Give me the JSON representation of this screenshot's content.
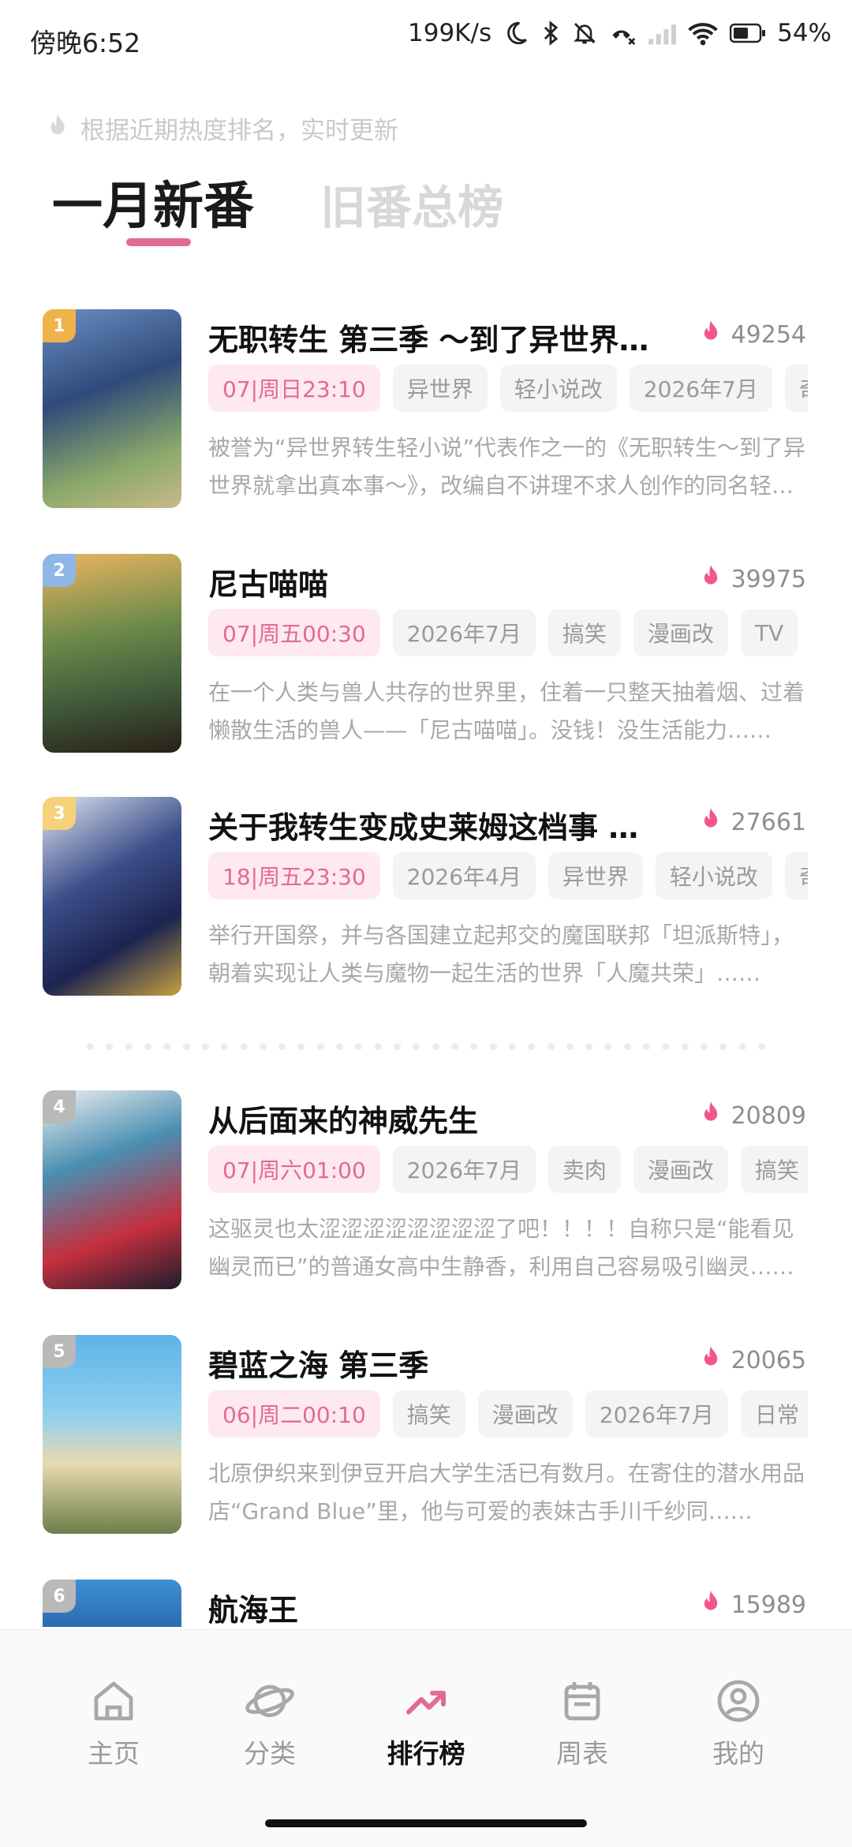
{
  "status": {
    "time": "傍晚6:52",
    "net_speed": "199K/s",
    "battery": "54%"
  },
  "header": {
    "hint": "根据近期热度排名，实时更新",
    "tabs": [
      "一月新番",
      "旧番总榜"
    ],
    "active_tab": "一月新番"
  },
  "items": [
    {
      "rank": "1",
      "title": "无职转生 第三季 ～到了异世界就拿出真本事～",
      "heat": "49254",
      "tags": [
        "07|周日23:10",
        "异世界",
        "轻小说改",
        "2026年7月",
        "奇幻"
      ],
      "desc": "被誉为“异世界转生轻小说”代表作之一的《无职转生～到了异世界就拿出真本事～》，改编自不讲理不求人创作的同名轻小说……"
    },
    {
      "rank": "2",
      "title": "尼古喵喵",
      "heat": "39975",
      "tags": [
        "07|周五00:30",
        "2026年7月",
        "搞笑",
        "漫画改",
        "TV"
      ],
      "desc": "在一个人类与兽人共存的世界里，住着一只整天抽着烟、过着懒散生活的兽人——「尼古喵喵」。没钱！没生活能力……"
    },
    {
      "rank": "3",
      "title": "关于我转生变成史莱姆这档事 第四季",
      "heat": "27661",
      "tags": [
        "18|周五23:30",
        "2026年4月",
        "异世界",
        "轻小说改",
        "奇幻"
      ],
      "desc": "举行开国祭，并与各国建立起邦交的魔国联邦「坦派斯特」，朝着实现让人类与魔物一起生活的世界「人魔共荣」……"
    },
    {
      "rank": "4",
      "title": "从后面来的神威先生",
      "heat": "20809",
      "tags": [
        "07|周六01:00",
        "2026年7月",
        "卖肉",
        "漫画改",
        "搞笑"
      ],
      "desc": "这驱灵也太涩涩涩涩涩涩涩涩了吧！！！！自称只是“能看见幽灵而已”的普通女高中生静香，利用自己容易吸引幽灵……"
    },
    {
      "rank": "5",
      "title": "碧蓝之海 第三季",
      "heat": "20065",
      "tags": [
        "06|周二00:10",
        "搞笑",
        "漫画改",
        "2026年7月",
        "日常"
      ],
      "desc": "北原伊织来到伊豆开启大学生活已有数月。在寄住的潜水用品店“Grand Blue”里，他与可爱的表妹古手川千纱同……"
    },
    {
      "rank": "6",
      "title": "航海王",
      "heat": "15989",
      "tags": [],
      "desc": ""
    }
  ],
  "bottom_nav": [
    {
      "label": "主页",
      "icon": "home-icon"
    },
    {
      "label": "分类",
      "icon": "planet-icon"
    },
    {
      "label": "排行榜",
      "icon": "trending-icon",
      "active": true
    },
    {
      "label": "周表",
      "icon": "calendar-icon"
    },
    {
      "label": "我的",
      "icon": "profile-icon"
    }
  ],
  "colors": {
    "accent": "#e36a93",
    "heat_flame": "#f2578a",
    "rank_gold": "#f0b24a",
    "rank_blue": "#8fb6e8",
    "rank_yellow": "#f5d27a",
    "rank_gray": "#b9b9b9"
  }
}
